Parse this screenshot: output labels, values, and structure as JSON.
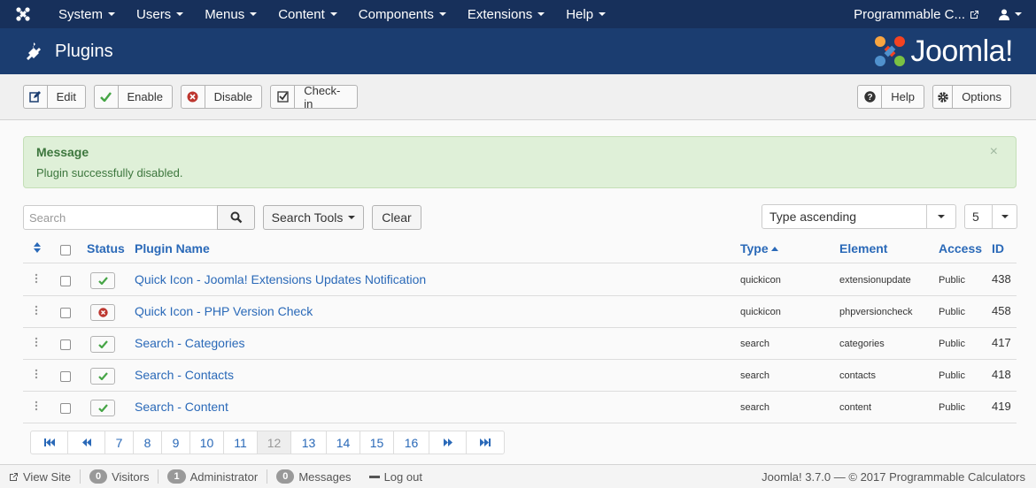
{
  "topnav": {
    "menus": [
      "System",
      "Users",
      "Menus",
      "Content",
      "Components",
      "Extensions",
      "Help"
    ],
    "site_name": "Programmable C..."
  },
  "header": {
    "title": "Plugins",
    "brand": "Joomla!"
  },
  "toolbar": {
    "edit": "Edit",
    "enable": "Enable",
    "disable": "Disable",
    "checkin": "Check-in",
    "help": "Help",
    "options": "Options"
  },
  "alert": {
    "heading": "Message",
    "body": "Plugin successfully disabled.",
    "close": "×"
  },
  "filters": {
    "search_placeholder": "Search",
    "search_tools": "Search Tools",
    "clear": "Clear",
    "sort": "Type ascending",
    "limit": "5"
  },
  "table": {
    "headers": {
      "status": "Status",
      "name": "Plugin Name",
      "type": "Type",
      "element": "Element",
      "access": "Access",
      "id": "ID"
    },
    "rows": [
      {
        "status": "enabled",
        "name": "Quick Icon - Joomla! Extensions Updates Notification",
        "type": "quickicon",
        "element": "extensionupdate",
        "access": "Public",
        "id": "438"
      },
      {
        "status": "disabled",
        "name": "Quick Icon - PHP Version Check",
        "type": "quickicon",
        "element": "phpversioncheck",
        "access": "Public",
        "id": "458"
      },
      {
        "status": "enabled",
        "name": "Search - Categories",
        "type": "search",
        "element": "categories",
        "access": "Public",
        "id": "417"
      },
      {
        "status": "enabled",
        "name": "Search - Contacts",
        "type": "search",
        "element": "contacts",
        "access": "Public",
        "id": "418"
      },
      {
        "status": "enabled",
        "name": "Search - Content",
        "type": "search",
        "element": "content",
        "access": "Public",
        "id": "419"
      }
    ]
  },
  "pagination": {
    "pages": [
      "7",
      "8",
      "9",
      "10",
      "11",
      "12",
      "13",
      "14",
      "15",
      "16"
    ],
    "active": "12"
  },
  "footer": {
    "view_site": "View Site",
    "visitors_count": "0",
    "visitors": "Visitors",
    "admin_count": "1",
    "admin": "Administrator",
    "messages_count": "0",
    "messages": "Messages",
    "logout": "Log out",
    "copyright": "Joomla! 3.7.0  —  © 2017 Programmable Calculators"
  },
  "colors": {
    "nav_bg": "#17305b",
    "header_bg": "#1b3d70",
    "link": "#2a69b8",
    "success": "#3c763d",
    "enabled_check": "#46a546",
    "disabled_x": "#bd362f"
  }
}
